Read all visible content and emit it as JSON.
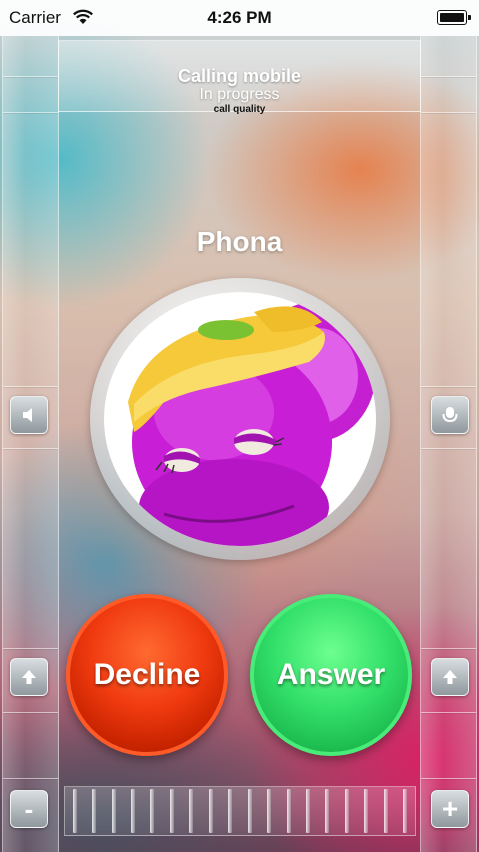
{
  "status_bar": {
    "carrier": "Carrier",
    "time": "4:26 PM"
  },
  "header": {
    "title": "Calling mobile",
    "subtitle": "In progress",
    "quality": "call quality"
  },
  "caller": {
    "name": "Phona"
  },
  "actions": {
    "decline_label": "Decline",
    "answer_label": "Answer"
  },
  "controls": {
    "left": [
      "speaker-icon",
      "arrow-up-icon",
      "minus-icon"
    ],
    "right": [
      "microphone-icon",
      "arrow-up-icon",
      "plus-icon"
    ],
    "minus_label": "-",
    "plus_label": "+"
  },
  "colors": {
    "decline": "#f03a10",
    "answer": "#33e06a"
  }
}
